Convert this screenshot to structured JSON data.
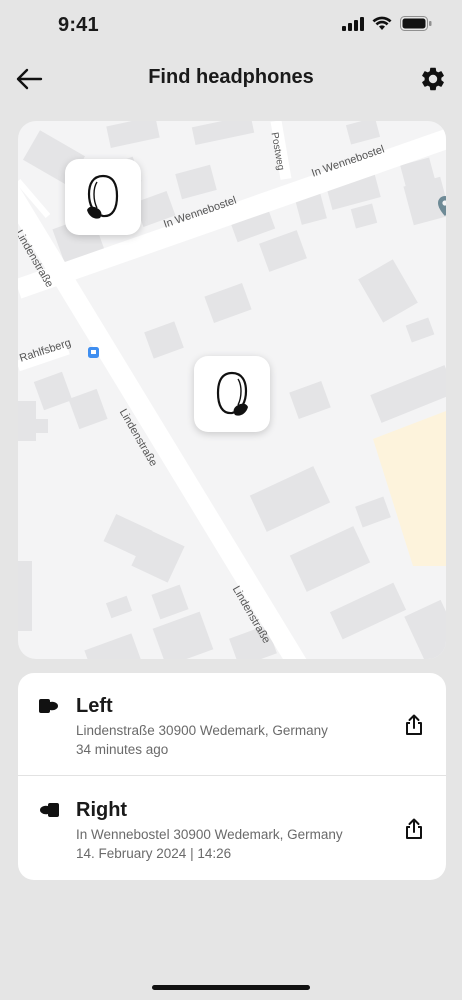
{
  "status_bar": {
    "time": "9:41",
    "icons": [
      "signal-icon",
      "wifi-icon",
      "battery-icon"
    ]
  },
  "header": {
    "title": "Find headphones",
    "back_icon": "arrow-left-icon",
    "settings_icon": "gear-icon"
  },
  "map": {
    "streets": {
      "in_wennebostel_1": "In Wennebostel",
      "in_wennebostel_2": "In Wennebostel",
      "lindenstrasse_1": "Lindenstraße",
      "lindenstrasse_2": "Lindenstraße",
      "lindenstrasse_3": "Lindenstraße",
      "rahlfsberg": "Rahlfsberg",
      "postweg": "Postweg"
    },
    "pins": [
      {
        "name": "left-earbud-pin",
        "icon": "earbud-icon"
      },
      {
        "name": "right-earbud-pin",
        "icon": "earbud-icon"
      }
    ],
    "colors": {
      "background": "#f4f4f5",
      "road": "#ffffff",
      "building": "#e4e4e6",
      "park": "#fdf3dc"
    }
  },
  "devices": [
    {
      "name": "Left",
      "address": "Lindenstraße 30900 Wedemark, Germany",
      "time": "34 minutes ago",
      "icon": "left-earbud-icon",
      "action_icon": "share-icon"
    },
    {
      "name": "Right",
      "address": "In Wennebostel 30900 Wedemark, Germany",
      "time": "14. February 2024 | 14:26",
      "icon": "right-earbud-icon",
      "action_icon": "share-icon"
    }
  ]
}
